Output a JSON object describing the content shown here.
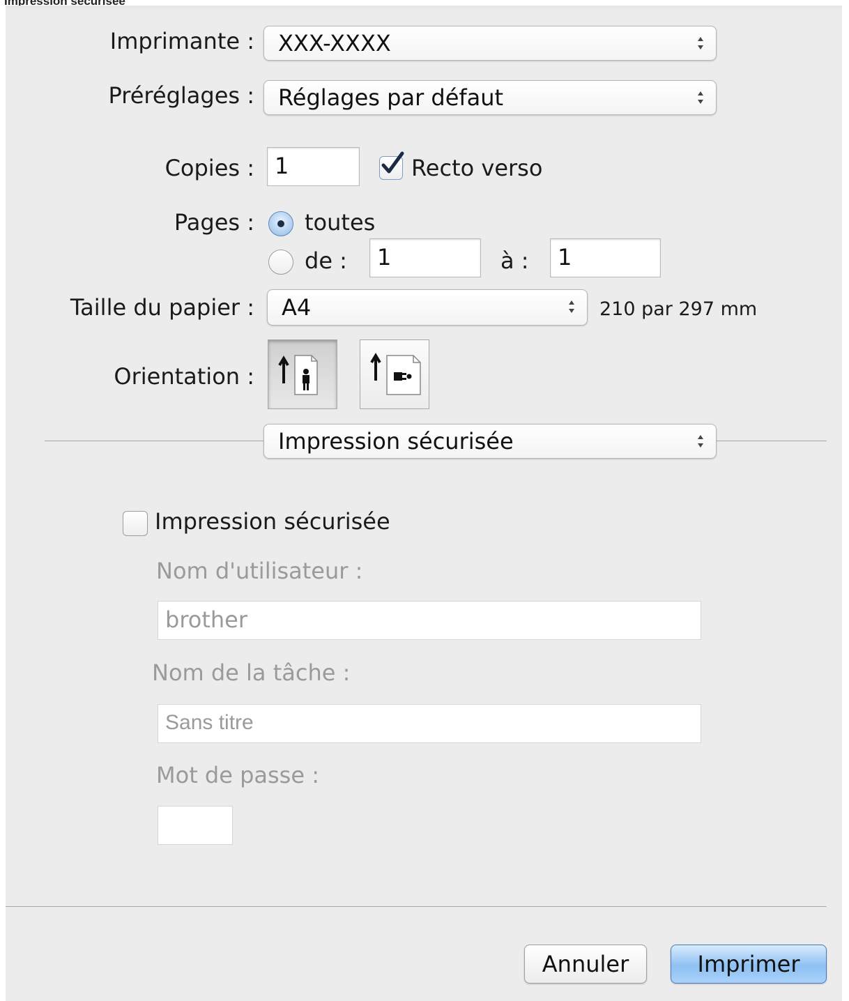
{
  "caption": "Impression sécurisée",
  "printer": {
    "label": "Imprimante :",
    "value": "XXX-XXXX"
  },
  "presets": {
    "label": "Préréglages :",
    "value": "Réglages par défaut"
  },
  "copies": {
    "label": "Copies :",
    "value": "1",
    "duplex_label": "Recto verso",
    "duplex_checked": true
  },
  "pages": {
    "label": "Pages :",
    "all_label": "toutes",
    "range_label": "de :",
    "from_value": "1",
    "to_label": "à :",
    "to_value": "1",
    "selected": "all"
  },
  "paper": {
    "label": "Taille du papier :",
    "value": "A4",
    "size_text": "210 par 297 mm"
  },
  "orientation": {
    "label": "Orientation :",
    "options": [
      "portrait",
      "landscape"
    ],
    "selected": "portrait"
  },
  "section_popup": {
    "value": "Impression sécurisée"
  },
  "secure": {
    "checkbox_label": "Impression sécurisée",
    "checked": false,
    "username_label": "Nom d'utilisateur :",
    "username_value": "brother",
    "job_label": "Nom de la tâche :",
    "job_placeholder": "Sans titre",
    "password_label": "Mot de passe :",
    "password_value": ""
  },
  "buttons": {
    "cancel": "Annuler",
    "print": "Imprimer"
  },
  "icons": {
    "popup_arrows": "updown-arrows-icon",
    "checkmark": "checkmark-icon",
    "portrait": "portrait-orientation-icon",
    "landscape": "landscape-orientation-icon"
  }
}
